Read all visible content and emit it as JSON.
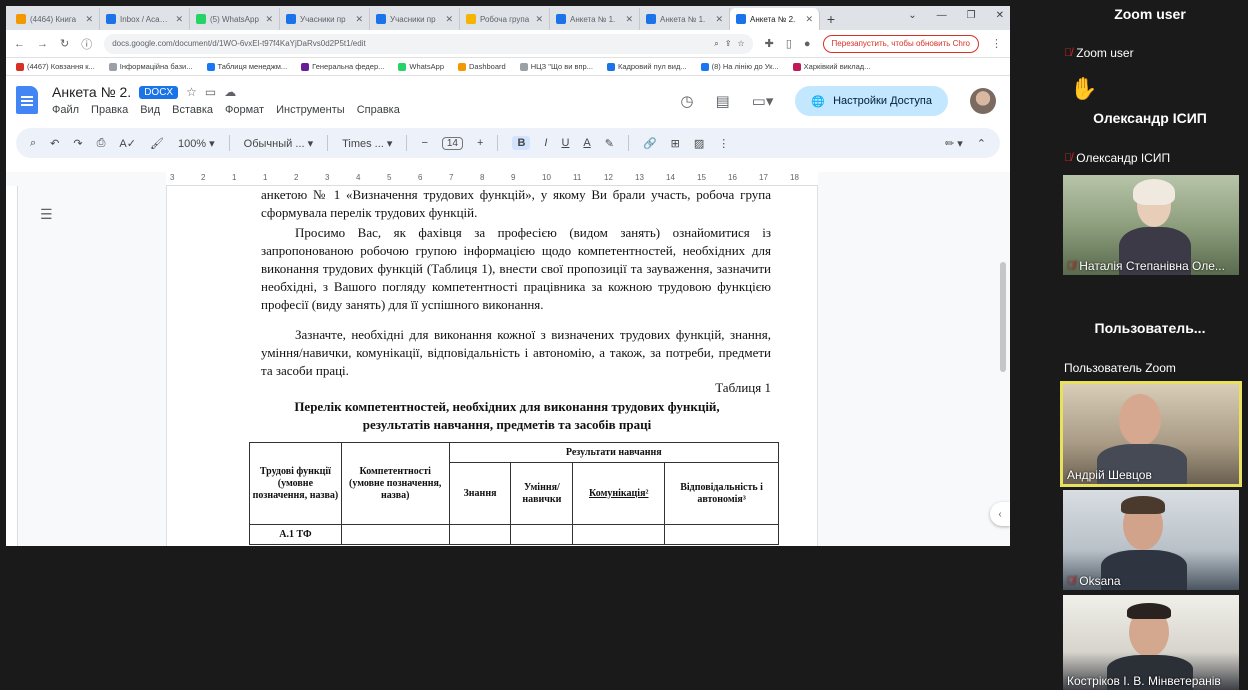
{
  "browser": {
    "tabs": [
      {
        "title": "(4464) Книга",
        "color": "#f29900"
      },
      {
        "title": "Inbox / Academ",
        "color": "#1a73e8"
      },
      {
        "title": "(5) WhatsApp",
        "color": "#25d366"
      },
      {
        "title": "Учасники пр",
        "color": "#1a73e8"
      },
      {
        "title": "Учасники пр",
        "color": "#1a73e8"
      },
      {
        "title": "Робоча група",
        "color": "#f4b400"
      },
      {
        "title": "Анкета № 1.",
        "color": "#1a73e8"
      },
      {
        "title": "Анкета № 1.",
        "color": "#1a73e8"
      },
      {
        "title": "Анкета № 2.",
        "color": "#1a73e8"
      }
    ],
    "new_tab": "+",
    "url": "docs.google.com/document/d/1WO-6vxEl-t97f4KaYjDaRvs0d2P5t1/edit",
    "relaunch_label": "Перезапустить, чтобы обновить Chro",
    "bookmarks": [
      {
        "label": "(4467) Ковзання к...",
        "color": "#d93025"
      },
      {
        "label": "Інформаційна бази...",
        "color": "#9aa0a6"
      },
      {
        "label": "Таблиця менеджм...",
        "color": "#1877f2"
      },
      {
        "label": "Генеральна федер...",
        "color": "#6a1b9a"
      },
      {
        "label": "WhatsApp",
        "color": "#25d366"
      },
      {
        "label": "Dashboard",
        "color": "#f29900"
      },
      {
        "label": "НЦЗ \"Що ви впр...",
        "color": "#9aa0a6"
      },
      {
        "label": "Кадровий пул вид...",
        "color": "#1a73e8"
      },
      {
        "label": "(8) На лінію до Ук...",
        "color": "#1877f2"
      },
      {
        "label": "Харківкий виклад...",
        "color": "#c2185b"
      }
    ]
  },
  "docs": {
    "title": "Анкета № 2.",
    "format_badge": "DOCX",
    "menus": [
      "Файл",
      "Правка",
      "Вид",
      "Вставка",
      "Формат",
      "Инструменты",
      "Справка"
    ],
    "share_label": "Настройки Доступа",
    "toolbar": {
      "zoom": "100%",
      "style": "Обычный ...",
      "font": "Times ...",
      "font_size": "14",
      "minus": "−",
      "plus": "+",
      "bold": "B",
      "italic": "I",
      "underline": "U",
      "text_color": "A"
    },
    "ruler_ticks": [
      "3",
      "2",
      "1",
      "1",
      "2",
      "3",
      "4",
      "5",
      "6",
      "7",
      "8",
      "9",
      "10",
      "11",
      "12",
      "13",
      "14",
      "15",
      "16",
      "17",
      "18"
    ],
    "para1": "анкетою № 1 «Визначення трудових функцій», у якому Ви брали участь, робоча група сформувала перелік трудових функцій.",
    "para2": "Просимо Вас, як фахівця за професією (видом занять) ознайомитися із запропонованою робочою групою інформацією щодо компетентностей, необхідних для виконання трудових функцій (Таблиця 1), внести свої пропозиції та зауваження, зазначити необхідні, з Вашого погляду компетентності працівника за кожною трудовою функцією професії (виду занять) для її успішного виконання.",
    "para3": "Зазначте, необхідні для виконання кожної з визначених трудових функцій, знання, уміння/навички, комунікації, відповідальність і автономію, а також, за потреби, предмети та засоби праці.",
    "table_caption": "Таблиця 1",
    "table_title_line1": "Перелік компетентностей, необхідних для виконання трудових функцій,",
    "table_title_line2": "результатів навчання, предметів та засобів праці",
    "table": {
      "col1": "Трудові функції (умовне позначення, назва)",
      "col2": "Компетентності (умовне позначення, назва)",
      "results": "Результати навчання",
      "sub1": "Знання",
      "sub2": "Уміння/ навички",
      "sub3": "Комунікація²",
      "sub4": "Відповідальність і автономія³",
      "row1": "А.1 ТФ"
    }
  },
  "zoom": {
    "tiles": [
      {
        "title": "Zoom user",
        "name": "Zoom user"
      },
      {
        "title": "Олександр ІСИП",
        "name": "Олександр ІСИП"
      },
      {
        "name": "Наталія Степанівна Оле..."
      },
      {
        "title": "Пользователь...",
        "name": "Пользователь Zoom"
      },
      {
        "name": "Андрій Шевцов"
      },
      {
        "name": "Oksana"
      },
      {
        "name": "Кострiков І. В. Мінветеранів"
      }
    ]
  },
  "colors": {
    "accent": "#1a73e8",
    "share_bg": "#c2e7ff",
    "active_speaker": "#e8e160",
    "muted": "#e02828"
  }
}
